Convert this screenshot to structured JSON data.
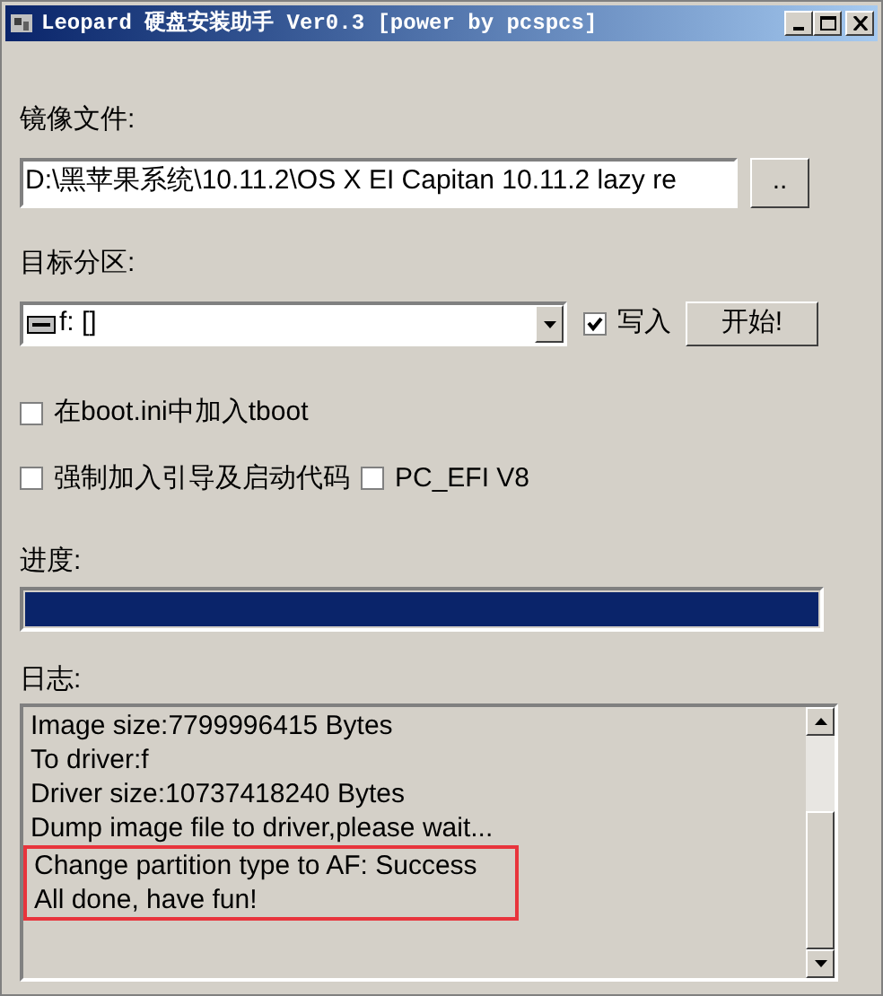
{
  "window": {
    "title": "Leopard 硬盘安装助手 Ver0.3 [power by pcspcs]"
  },
  "image_file": {
    "label": "镜像文件:",
    "value": "D:\\黑苹果系统\\10.11.2\\OS X EI Capitan 10.11.2 lazy re",
    "browse_button": ".."
  },
  "target_partition": {
    "label": "目标分区:",
    "value": "f: []",
    "write_checkbox": {
      "label": "写入",
      "checked": true
    },
    "start_button": "开始!"
  },
  "options": [
    {
      "label": "在boot.ini中加入tboot",
      "checked": false
    },
    {
      "label": "强制加入引导及启动代码",
      "checked": false
    },
    {
      "label": "PC_EFI V8",
      "checked": false
    }
  ],
  "progress": {
    "label": "进度:",
    "level": 1
  },
  "log": {
    "label": "日志:",
    "lines": [
      {
        "text": "Image size:7799996415 Bytes",
        "highlighted": false
      },
      {
        "text": "To driver:f",
        "highlighted": false
      },
      {
        "text": "Driver size:10737418240 Bytes",
        "highlighted": false
      },
      {
        "text": "Dump image file to driver,please wait...",
        "highlighted": false
      },
      {
        "text": "Change partition type to AF: Success",
        "highlighted": true
      },
      {
        "text": "All done, have fun!",
        "highlighted": true
      }
    ]
  }
}
